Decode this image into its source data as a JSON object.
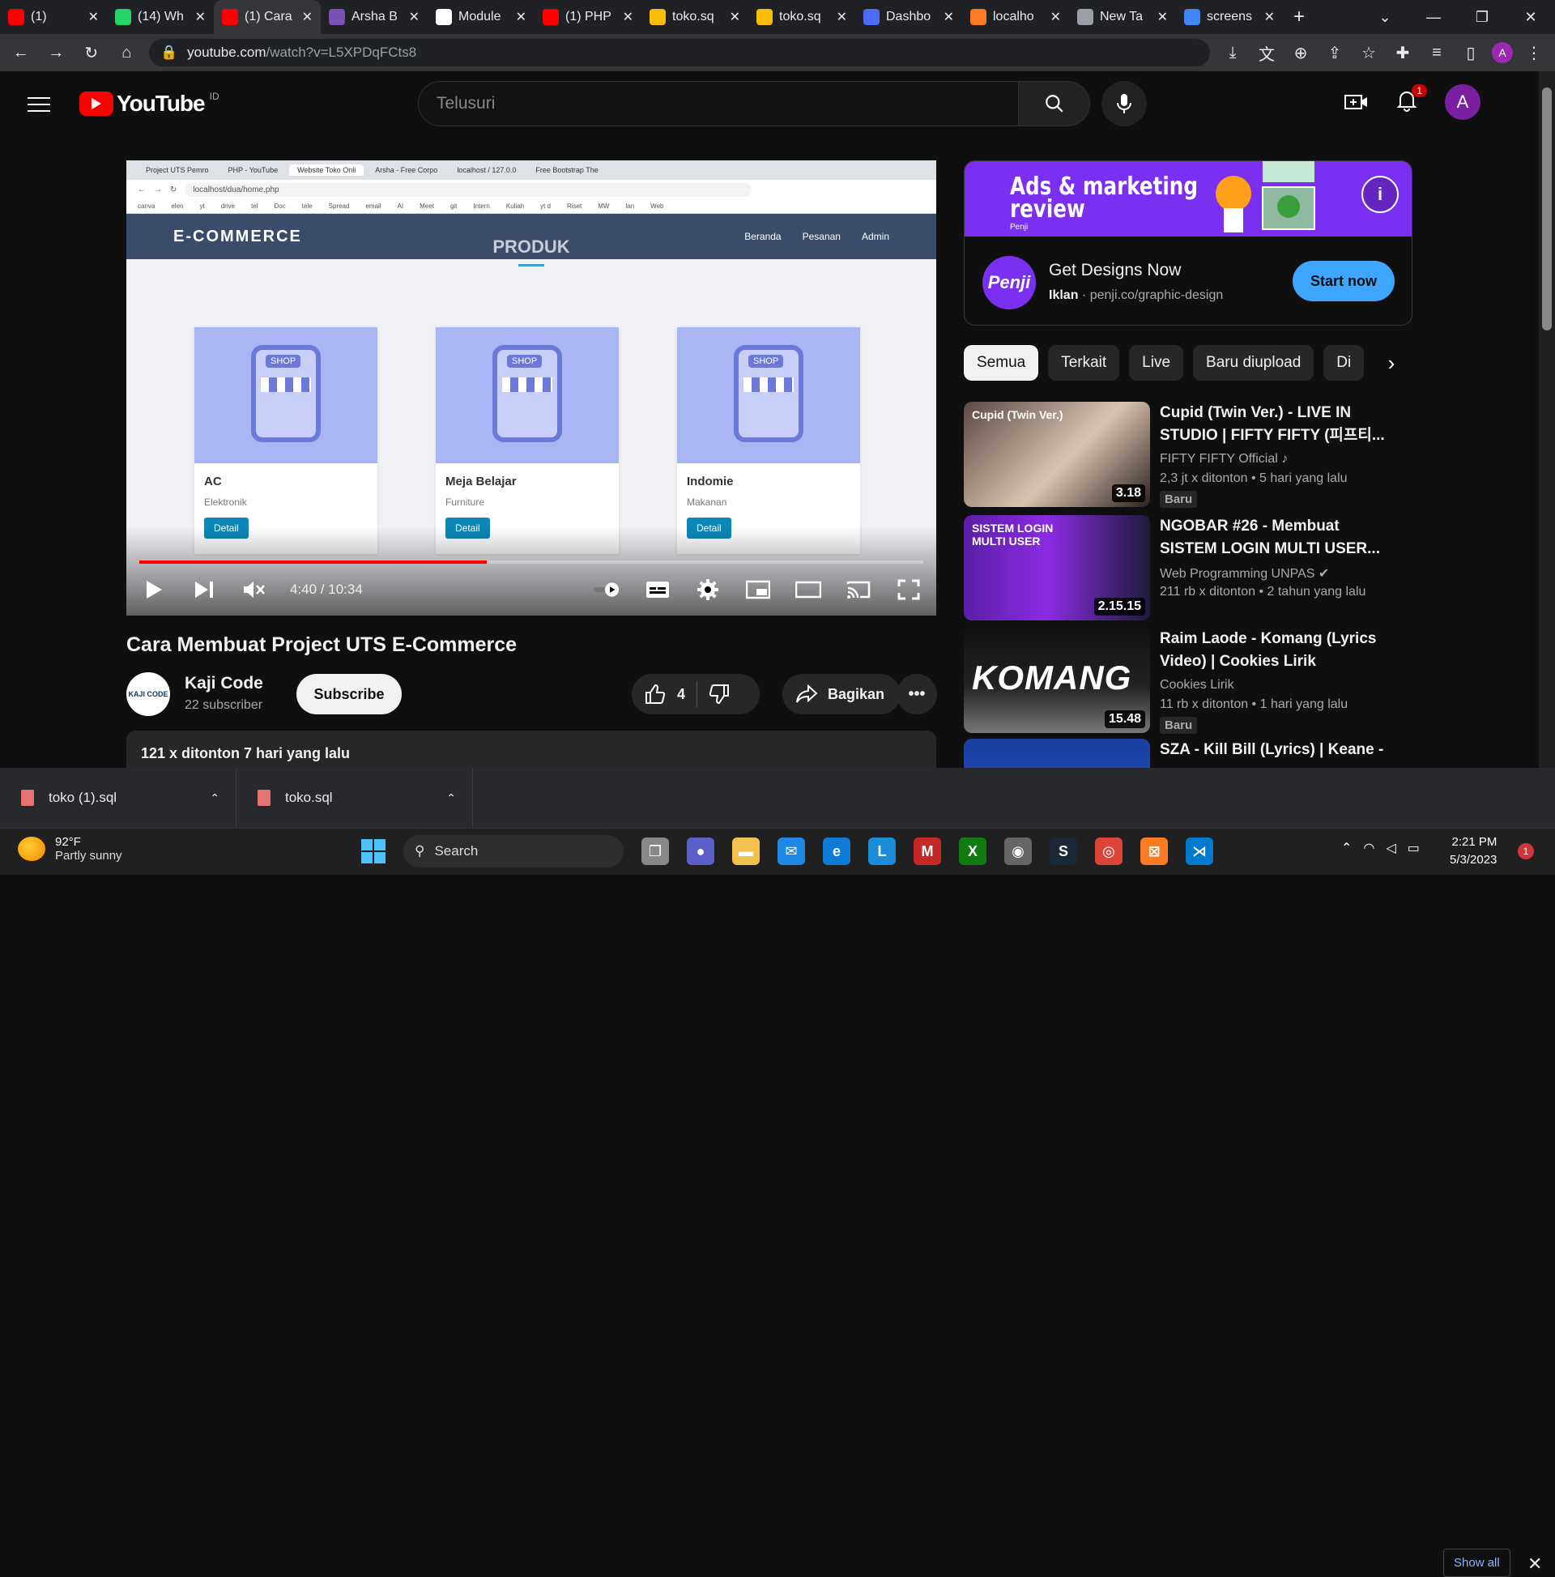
{
  "browser": {
    "tabs": [
      {
        "label": "(1)",
        "icon": "youtube-icon",
        "color": "#ff0000"
      },
      {
        "label": "(14) Wh",
        "icon": "whatsapp-icon",
        "color": "#25d366"
      },
      {
        "label": "(1) Cara",
        "icon": "youtube-icon",
        "color": "#ff0000",
        "active": true
      },
      {
        "label": "Arsha B",
        "icon": "bootstrap-icon",
        "color": "#7952b3"
      },
      {
        "label": "Module",
        "icon": "notion-icon",
        "color": "#ffffff"
      },
      {
        "label": "(1) PHP",
        "icon": "youtube-icon",
        "color": "#ff0000"
      },
      {
        "label": "toko.sq",
        "icon": "drive-icon",
        "color": "#fbbc04"
      },
      {
        "label": "toko.sq",
        "icon": "drive-icon",
        "color": "#fbbc04"
      },
      {
        "label": "Dashbo",
        "icon": "dashboard-icon",
        "color": "#4a6cf7"
      },
      {
        "label": "localho",
        "icon": "xampp-icon",
        "color": "#fb7a24"
      },
      {
        "label": "New Ta",
        "icon": "chrome-icon",
        "color": "#9aa0a6"
      },
      {
        "label": "screens",
        "icon": "google-icon",
        "color": "#4285f4"
      }
    ],
    "url_host": "youtube.com",
    "url_path": "/watch?v=L5XPDqFCts8",
    "profile_initial": "A"
  },
  "youtube": {
    "logo_text": "YouTube",
    "country_code": "ID",
    "search_placeholder": "Telusuri",
    "notification_count": "1",
    "avatar_initial": "A"
  },
  "player": {
    "time": "4:40 / 10:34",
    "progress_fraction": 0.443,
    "inner_browser": {
      "tabs": [
        "Project UTS Pemro",
        "PHP - YouTube",
        "Website Toko Onli",
        "Arsha - Free Corpo",
        "localhost / 127.0.0",
        "Free Bootstrap The"
      ],
      "address": "localhost/dua/home.php",
      "bookmarks": [
        "canva",
        "elen",
        "yt",
        "drive",
        "tel",
        "Doc",
        "tele",
        "Spread",
        "email",
        "AI",
        "Meet",
        "git",
        "Intern",
        "Kuliah",
        "yt d",
        "Riset",
        "MW",
        "lan",
        "Web"
      ]
    },
    "site": {
      "brand": "E-COMMERCE",
      "nav": [
        "Beranda",
        "Pesanan",
        "Admin"
      ],
      "section_heading": "PRODUK",
      "products": [
        {
          "name": "AC",
          "category": "Elektronik",
          "button": "Detail"
        },
        {
          "name": "Meja Belajar",
          "category": "Furniture",
          "button": "Detail"
        },
        {
          "name": "Indomie",
          "category": "Makanan",
          "button": "Detail"
        }
      ]
    }
  },
  "video": {
    "title": "Cara Membuat Project UTS E-Commerce",
    "channel_name": "Kaji Code",
    "channel_logo_text": "KAJI CODE",
    "subscribers": "22 subscriber",
    "subscribe_label": "Subscribe",
    "likes": "4",
    "share_label": "Bagikan",
    "views_date": "121 x ditonton  7 hari yang lalu"
  },
  "ad": {
    "banner_heading_line1": "Ads & marketing",
    "banner_heading_line2": "review",
    "banner_brand": "Penji",
    "logo_text": "Penji",
    "title": "Get Designs Now",
    "label": "Iklan",
    "domain": "penji.co/graphic-design",
    "cta": "Start now",
    "brand_color": "#7b2ff0"
  },
  "chips": [
    "Semua",
    "Terkait",
    "Live",
    "Baru diupload",
    "Di"
  ],
  "recommendations": [
    {
      "title": "Cupid (Twin Ver.) - LIVE IN STUDIO | FIFTY FIFTY (피프티...",
      "channel": "FIFTY FIFTY Official",
      "channel_icon": "music-note-icon",
      "views": "2,3 jt x ditonton",
      "age": "5 hari yang lalu",
      "duration": "3.18",
      "badge": "Baru",
      "thumb_text": "Cupid (Twin Ver.)"
    },
    {
      "title": "NGOBAR #26 - Membuat SISTEM LOGIN MULTI USER...",
      "channel": "Web Programming UNPAS",
      "channel_icon": "verified-icon",
      "views": "211 rb x ditonton",
      "age": "2 tahun yang lalu",
      "duration": "2.15.15",
      "badge": "",
      "thumb_text": "SISTEM LOGIN MULTI USER"
    },
    {
      "title": "Raim Laode - Komang (Lyrics Video) | Cookies Lirik",
      "channel": "Cookies Lirik",
      "channel_icon": "",
      "views": "11 rb x ditonton",
      "age": "1 hari yang lalu",
      "duration": "15.48",
      "badge": "Baru",
      "thumb_text": "KOMANG"
    },
    {
      "title": "SZA - Kill Bill (Lyrics) | Keane -",
      "channel": "",
      "channel_icon": "",
      "views": "",
      "age": "",
      "duration": "",
      "badge": "",
      "thumb_text": ""
    }
  ],
  "downloads": {
    "items": [
      {
        "name": "toko (1).sql"
      },
      {
        "name": "toko.sql"
      }
    ],
    "show_all": "Show all"
  },
  "taskbar": {
    "temperature": "92°F",
    "weather": "Partly sunny",
    "search_label": "Search",
    "time": "2:21 PM",
    "date": "5/3/2023",
    "notification_count": "1"
  }
}
